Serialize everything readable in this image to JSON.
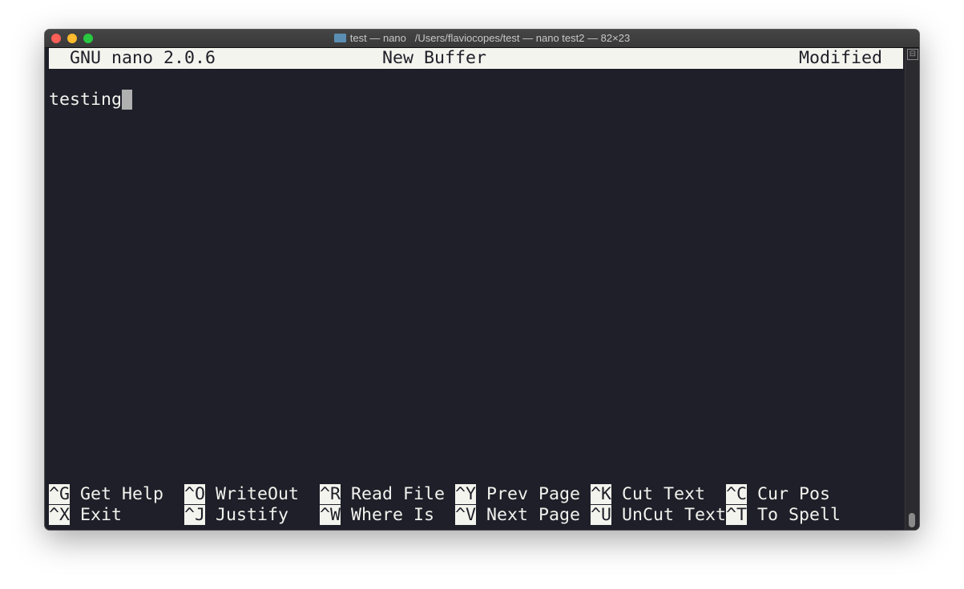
{
  "window": {
    "title_folder": "test — nano",
    "title_path": "/Users/flaviocopes/test — nano test2 — 82×23",
    "traffic_lights": {
      "close": "#fe5f57",
      "minimize": "#febc2e",
      "zoom": "#28c840"
    }
  },
  "header": {
    "app": "GNU nano 2.0.6",
    "buffer": "New Buffer",
    "status": "Modified"
  },
  "buffer": {
    "lines": [
      "testing"
    ]
  },
  "shortcuts": [
    [
      {
        "key": "^G",
        "label": "Get Help"
      },
      {
        "key": "^O",
        "label": "WriteOut"
      },
      {
        "key": "^R",
        "label": "Read File"
      },
      {
        "key": "^Y",
        "label": "Prev Page"
      },
      {
        "key": "^K",
        "label": "Cut Text"
      },
      {
        "key": "^C",
        "label": "Cur Pos"
      }
    ],
    [
      {
        "key": "^X",
        "label": "Exit"
      },
      {
        "key": "^J",
        "label": "Justify"
      },
      {
        "key": "^W",
        "label": "Where Is"
      },
      {
        "key": "^V",
        "label": "Next Page"
      },
      {
        "key": "^U",
        "label": "UnCut Text"
      },
      {
        "key": "^T",
        "label": "To Spell"
      }
    ]
  ],
  "colors": {
    "background": "#1f1f29",
    "foreground": "#f2f2ee",
    "inverse": "#f4f4ee"
  }
}
